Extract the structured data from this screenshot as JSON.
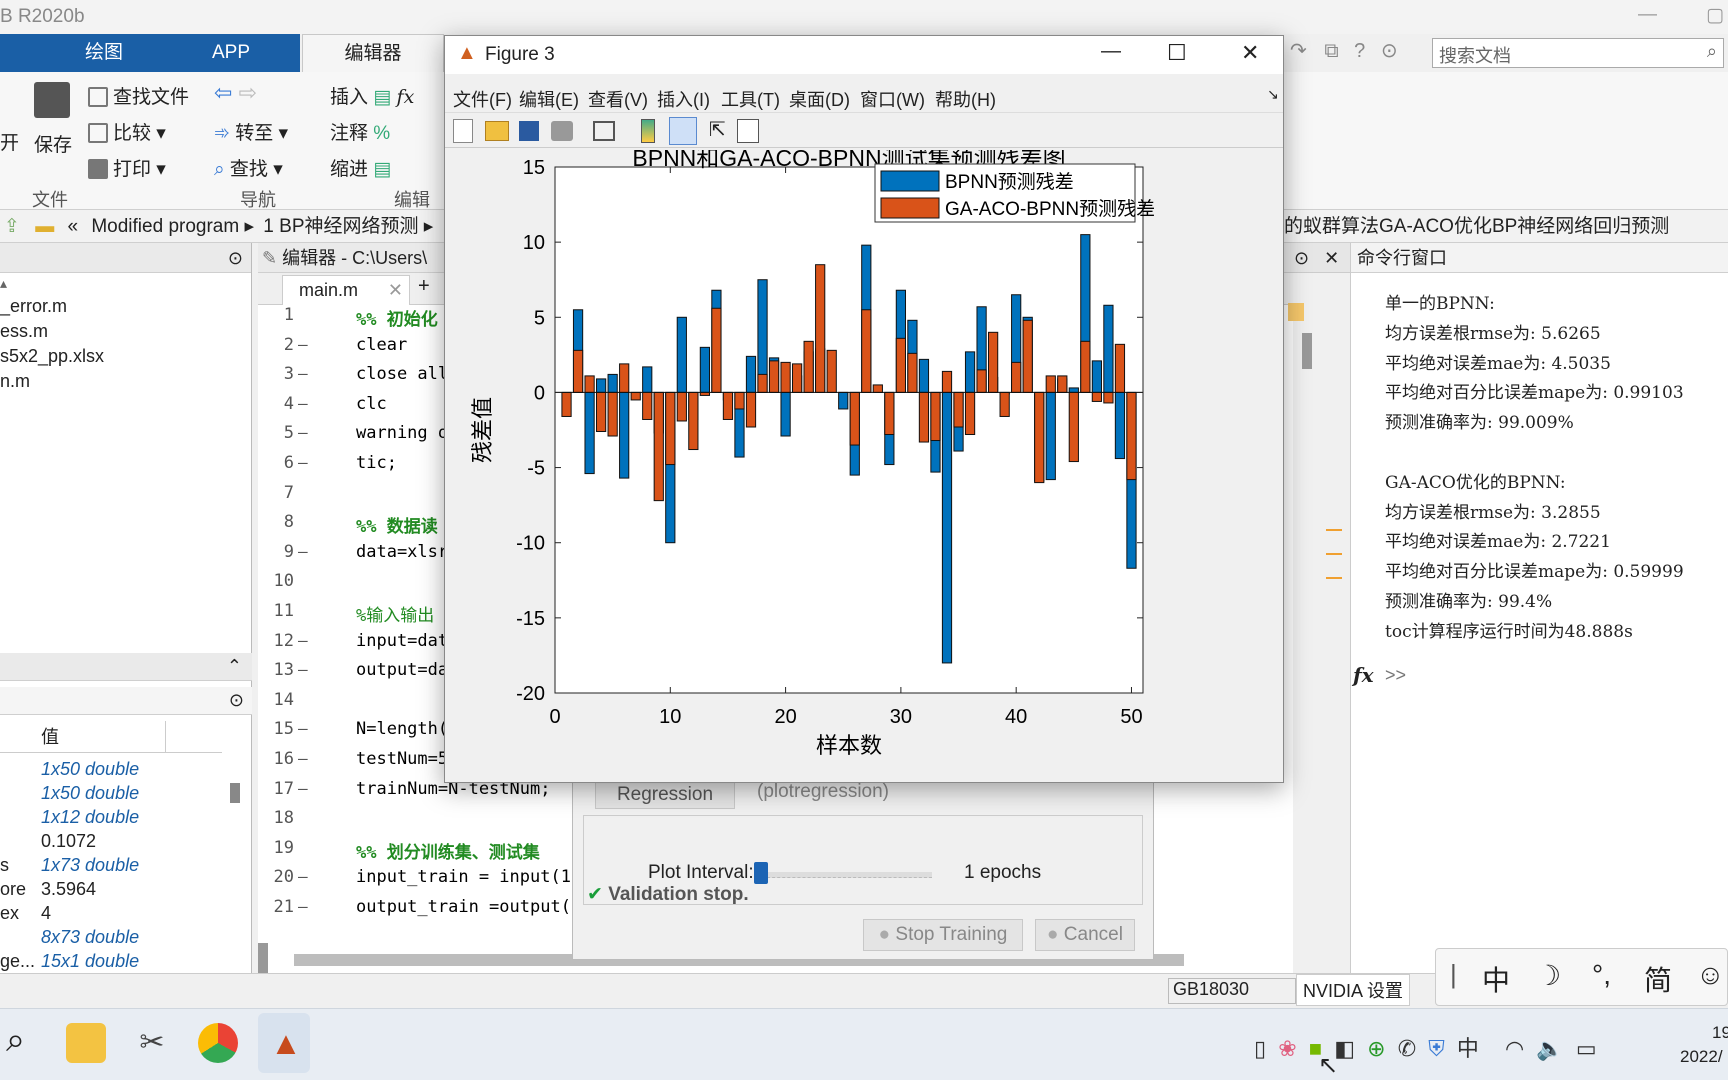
{
  "app": {
    "title": "B R2020b"
  },
  "ribbon_tabs": [
    "绘图",
    "APP",
    "编辑器"
  ],
  "search": {
    "placeholder": "搜索文档"
  },
  "ribbon": {
    "find_files": "查找文件",
    "compare": "比较",
    "print": "打印",
    "save": "保存",
    "open": "开",
    "goto": "转至",
    "find": "查找",
    "insert": "插入",
    "comment": "注释",
    "indent": "缩进",
    "groups": {
      "file": "文件",
      "nav": "导航",
      "edit": "编辑"
    }
  },
  "address": {
    "prefix": "«",
    "crumb1": "Modified program",
    "crumb2": "1 BP神经网络预测",
    "crumb3": "的蚁群算法GA-ACO优化BP神经网络回归预测"
  },
  "files": [
    "_error.m",
    "ess.m",
    "s5x2_pp.xlsx",
    "n.m"
  ],
  "workspace": {
    "col_value": "值",
    "rows": [
      {
        "name": "",
        "value": "1x50 double",
        "italic": true
      },
      {
        "name": "",
        "value": "1x50 double",
        "italic": true
      },
      {
        "name": "",
        "value": "1x12 double",
        "italic": true
      },
      {
        "name": "",
        "value": "0.1072",
        "italic": false
      },
      {
        "name": "s",
        "value": "1x73 double",
        "italic": true
      },
      {
        "name": "ore",
        "value": "3.5964",
        "italic": false
      },
      {
        "name": "ex",
        "value": "4",
        "italic": false
      },
      {
        "name": "",
        "value": "8x73 double",
        "italic": true
      },
      {
        "name": "ge...",
        "value": "15x1 double",
        "italic": true
      }
    ]
  },
  "editor": {
    "header": "编辑器 - C:\\Users\\",
    "tab": "main.m",
    "lines": [
      {
        "n": "1",
        "dash": false,
        "text": "%% 初始化",
        "cmt": true
      },
      {
        "n": "2",
        "dash": true,
        "text": "clear",
        "cmt": false
      },
      {
        "n": "3",
        "dash": true,
        "text": "close all",
        "cmt": false
      },
      {
        "n": "4",
        "dash": true,
        "text": "clc",
        "cmt": false
      },
      {
        "n": "5",
        "dash": true,
        "text": "warning o",
        "cmt": false
      },
      {
        "n": "6",
        "dash": true,
        "text": "tic;",
        "cmt": false
      },
      {
        "n": "7",
        "dash": false,
        "text": "",
        "cmt": false
      },
      {
        "n": "8",
        "dash": false,
        "text": "%% 数据读",
        "cmt": true
      },
      {
        "n": "9",
        "dash": true,
        "text": "data=xlsr",
        "cmt": false
      },
      {
        "n": "10",
        "dash": false,
        "text": "",
        "cmt": false
      },
      {
        "n": "11",
        "dash": false,
        "text": "%输入输出",
        "cmt": false
      },
      {
        "n": "12",
        "dash": true,
        "text": "input=dat",
        "cmt": false
      },
      {
        "n": "13",
        "dash": true,
        "text": "output=da",
        "cmt": false
      },
      {
        "n": "14",
        "dash": false,
        "text": "",
        "cmt": false
      },
      {
        "n": "15",
        "dash": true,
        "text": "N=length(",
        "cmt": false
      },
      {
        "n": "16",
        "dash": true,
        "text": "testNum=5",
        "cmt": false
      },
      {
        "n": "17",
        "dash": true,
        "text": "trainNum=N-testNum;",
        "cmt": false
      },
      {
        "n": "18",
        "dash": false,
        "text": "",
        "cmt": false
      },
      {
        "n": "19",
        "dash": false,
        "text": "%% 划分训练集、测试集",
        "cmt": true
      },
      {
        "n": "20",
        "dash": true,
        "text": "input_train = input(1:",
        "cmt": false
      },
      {
        "n": "21",
        "dash": true,
        "text": "output_train =output(1",
        "cmt": false
      }
    ]
  },
  "command": {
    "title": "命令行窗口",
    "lines": [
      "单一的BPNN:",
      "均方误差根rmse为:      5.6265",
      "平均绝对误差mae为:     4.5035",
      "平均绝对百分比误差mape为:  0.99103",
      "预测准确率为:   99.009%",
      "",
      "GA-ACO优化的BPNN:",
      "均方误差根rmse为:      3.2855",
      "平均绝对误差mae为:     2.7221",
      "平均绝对百分比误差mape为:  0.59999",
      "预测准确率为:   99.4%",
      "toc计算程序运行时间为48.888s"
    ],
    "prompt": ">>"
  },
  "training": {
    "regression_btn": "Regression",
    "regression_fn": "(plotregression)",
    "plot_interval_label": "Plot Interval:",
    "plot_interval_value": "1 epochs",
    "status": "Validation stop.",
    "stop_btn": "Stop Training",
    "cancel_btn": "Cancel"
  },
  "figure": {
    "title": "Figure 3",
    "menu": [
      "文件(F)",
      "编辑(E)",
      "查看(V)",
      "插入(I)",
      "工具(T)",
      "桌面(D)",
      "窗口(W)",
      "帮助(H)"
    ]
  },
  "chart_data": {
    "type": "bar",
    "title": "BPNN和GA-ACO-BPNN测试集预测残差图",
    "xlabel": "样本数",
    "ylabel": "残差值",
    "xlim": [
      0,
      51
    ],
    "ylim": [
      -20,
      15
    ],
    "xticks": [
      0,
      10,
      20,
      30,
      40,
      50
    ],
    "yticks": [
      -20,
      -15,
      -10,
      -5,
      0,
      5,
      10,
      15
    ],
    "legend_position": "top-right",
    "grid": false,
    "x": [
      1,
      2,
      3,
      4,
      5,
      6,
      7,
      8,
      9,
      10,
      11,
      12,
      13,
      14,
      15,
      16,
      17,
      18,
      19,
      20,
      21,
      22,
      23,
      24,
      25,
      26,
      27,
      28,
      29,
      30,
      31,
      32,
      33,
      34,
      35,
      36,
      37,
      38,
      39,
      40,
      41,
      42,
      43,
      44,
      45,
      46,
      47,
      48,
      49,
      50
    ],
    "series": [
      {
        "name": "BPNN预测残差",
        "color": "#0072BD",
        "values": [
          0,
          5.5,
          -5.4,
          0.9,
          1.2,
          -5.7,
          0,
          1.7,
          -2.7,
          -10,
          5,
          -1.8,
          3,
          6.8,
          -0.5,
          -4.3,
          2.4,
          7.5,
          2.3,
          -2.9,
          1.1,
          2.7,
          2.9,
          0,
          -1.1,
          -5.5,
          9.8,
          0,
          -4.8,
          6.8,
          4.8,
          2.2,
          -5.3,
          -18,
          -3.9,
          2.7,
          5.7,
          1,
          -0.1,
          6.5,
          5,
          -5.9,
          -5.8,
          0.9,
          0.3,
          10.5,
          2.1,
          5.8,
          -4.4,
          -11.7
        ]
      },
      {
        "name": "GA-ACO-BPNN预测残差",
        "color": "#D95319",
        "values": [
          -1.6,
          2.8,
          1.1,
          -2.6,
          -2.9,
          1.9,
          -0.5,
          -1.8,
          -7.2,
          -4.8,
          -1.9,
          -3.8,
          -0.2,
          5.6,
          -1.8,
          -1.1,
          -2.3,
          1.2,
          2.1,
          2,
          1.9,
          3.4,
          8.5,
          2.8,
          0,
          -3.5,
          5.5,
          0.5,
          -2.8,
          3.6,
          2.6,
          -3.3,
          -3.2,
          1.4,
          -2.3,
          -2.8,
          1.5,
          4,
          -1.6,
          2,
          4.8,
          -6,
          1.1,
          1.1,
          -4.6,
          3.4,
          -0.6,
          -0.7,
          3.2,
          -5.8
        ]
      }
    ]
  },
  "taskbar": {
    "nvidia": "NVIDIA 设置",
    "clock_time": "19",
    "clock_date": "2022/",
    "encoding": "GB18030",
    "ime": [
      "中",
      "简"
    ]
  }
}
